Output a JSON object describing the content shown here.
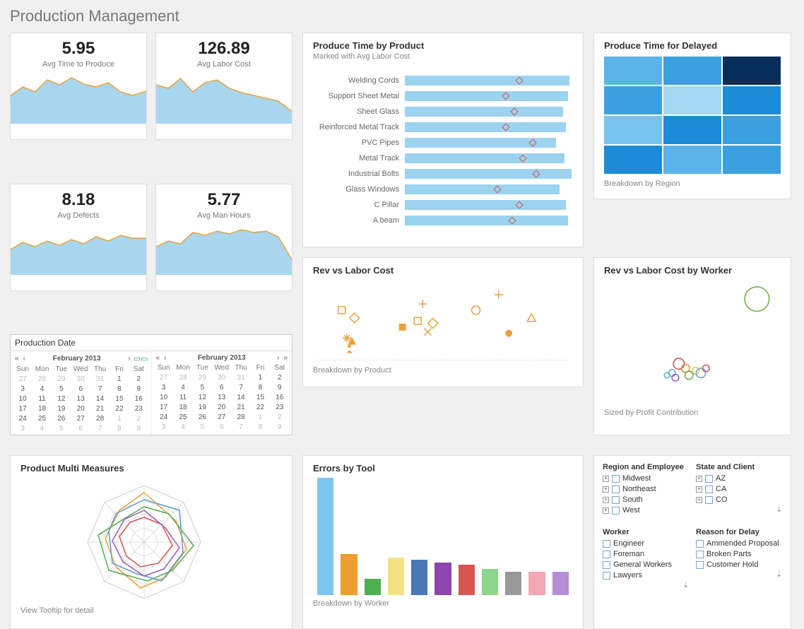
{
  "page_title": "Production Management",
  "kpis": [
    {
      "value": "5.95",
      "label": "Avg Time to Produce",
      "spark": [
        40,
        55,
        48,
        70,
        60,
        75,
        62,
        58,
        66,
        50,
        45,
        52
      ]
    },
    {
      "value": "126.89",
      "label": "Avg Labor Cost",
      "spark": [
        60,
        55,
        72,
        50,
        65,
        70,
        58,
        52,
        48,
        45,
        40,
        28
      ]
    },
    {
      "value": "8.18",
      "label": "Avg Defects",
      "spark": [
        40,
        52,
        44,
        55,
        48,
        58,
        50,
        62,
        55,
        65,
        60,
        60
      ]
    },
    {
      "value": "5.77",
      "label": "Avg Man Hours",
      "spark": [
        45,
        55,
        50,
        68,
        62,
        70,
        65,
        72,
        68,
        70,
        60,
        30
      ]
    }
  ],
  "calendar": {
    "title": "Production Date",
    "month_left": "February 2013",
    "month_right": "February 2013",
    "days": [
      "Sun",
      "Mon",
      "Tue",
      "Wed",
      "Thu",
      "Fri",
      "Sat"
    ],
    "rows": [
      [
        27,
        28,
        29,
        30,
        31,
        1,
        2
      ],
      [
        3,
        4,
        5,
        6,
        7,
        8,
        9
      ],
      [
        10,
        11,
        12,
        13,
        14,
        15,
        16
      ],
      [
        17,
        18,
        19,
        20,
        21,
        22,
        23
      ],
      [
        24,
        25,
        26,
        27,
        28,
        1,
        2
      ],
      [
        3,
        4,
        5,
        6,
        7,
        8,
        9
      ]
    ]
  },
  "produce_time": {
    "title": "Produce Time by Product",
    "subtitle": "Marked with Avg Labor Cost",
    "items": [
      {
        "label": "Welding Cords",
        "bar": 98,
        "marker": 68
      },
      {
        "label": "Support Sheet Metal",
        "bar": 97,
        "marker": 60
      },
      {
        "label": "Sheet Glass",
        "bar": 94,
        "marker": 65
      },
      {
        "label": "Reinforced Metal Track",
        "bar": 96,
        "marker": 60
      },
      {
        "label": "PVC Pipes",
        "bar": 90,
        "marker": 76
      },
      {
        "label": "Metal Track",
        "bar": 95,
        "marker": 70
      },
      {
        "label": "Industrial Bolts",
        "bar": 99,
        "marker": 78
      },
      {
        "label": "Glass Windows",
        "bar": 92,
        "marker": 55
      },
      {
        "label": "C Pillar",
        "bar": 96,
        "marker": 68
      },
      {
        "label": "A beam",
        "bar": 97,
        "marker": 64
      }
    ]
  },
  "rev_labor": {
    "title": "Rev vs Labor Cost",
    "footnote": "Breakdown by Product",
    "points": [
      {
        "x": 10,
        "y": 38,
        "shape": "square-o"
      },
      {
        "x": 15,
        "y": 48,
        "shape": "diamond-o"
      },
      {
        "x": 12,
        "y": 74,
        "shape": "burst"
      },
      {
        "x": 14,
        "y": 78,
        "shape": "triangle"
      },
      {
        "x": 13,
        "y": 88,
        "shape": "person"
      },
      {
        "x": 34,
        "y": 60,
        "shape": "square"
      },
      {
        "x": 40,
        "y": 52,
        "shape": "square-o"
      },
      {
        "x": 44,
        "y": 66,
        "shape": "x"
      },
      {
        "x": 42,
        "y": 30,
        "shape": "plus"
      },
      {
        "x": 46,
        "y": 55,
        "shape": "diamond-o"
      },
      {
        "x": 63,
        "y": 38,
        "shape": "circle-o"
      },
      {
        "x": 72,
        "y": 18,
        "shape": "plus"
      },
      {
        "x": 76,
        "y": 68,
        "shape": "circle"
      },
      {
        "x": 85,
        "y": 48,
        "shape": "triangle-o"
      }
    ]
  },
  "produce_delayed": {
    "title": "Produce Time for Delayed",
    "footnote": "Breakdown by Region",
    "cells": [
      "#5ab4ea",
      "#3aa0e0",
      "#0a2e5c",
      "#3aa0e0",
      "#a6d8f5",
      "#1d8bd8",
      "#7ac3ee",
      "#1d8bd8",
      "#3aa0e0",
      "#1d8bd8",
      "#5ab4ea",
      "#3aa0e0"
    ]
  },
  "rev_worker": {
    "title": "Rev vs Labor Cost by Worker",
    "footnote": "Sized by Profit Contribution",
    "bubbles": [
      {
        "x": 88,
        "y": 14,
        "r": 18,
        "c": "#6aaa3a"
      },
      {
        "x": 42,
        "y": 70,
        "r": 8,
        "c": "#c94a4a"
      },
      {
        "x": 46,
        "y": 74,
        "r": 6,
        "c": "#e0892c"
      },
      {
        "x": 38,
        "y": 78,
        "r": 5,
        "c": "#5a9bd5"
      },
      {
        "x": 48,
        "y": 80,
        "r": 6,
        "c": "#6aaa3a"
      },
      {
        "x": 40,
        "y": 82,
        "r": 5,
        "c": "#9b59b6"
      },
      {
        "x": 35,
        "y": 80,
        "r": 4,
        "c": "#4bbaba"
      },
      {
        "x": 52,
        "y": 76,
        "r": 5,
        "c": "#d8c24a"
      },
      {
        "x": 55,
        "y": 78,
        "r": 7,
        "c": "#5a9bd5"
      },
      {
        "x": 58,
        "y": 74,
        "r": 5,
        "c": "#c94a4a"
      }
    ]
  },
  "multi_measures": {
    "title": "Product Multi Measures",
    "footnote": "View Tooltip for detail"
  },
  "errors_tool": {
    "title": "Errors by Tool",
    "footnote": "Breakdown by Worker",
    "bars": [
      {
        "v": 100,
        "c": "#7dc7ee"
      },
      {
        "v": 35,
        "c": "#f19c2e"
      },
      {
        "v": 14,
        "c": "#4caf50"
      },
      {
        "v": 32,
        "c": "#f4e183"
      },
      {
        "v": 30,
        "c": "#4a78b5"
      },
      {
        "v": 28,
        "c": "#8e44ad"
      },
      {
        "v": 26,
        "c": "#d9534f"
      },
      {
        "v": 22,
        "c": "#8bd68b"
      },
      {
        "v": 20,
        "c": "#999"
      },
      {
        "v": 20,
        "c": "#f2a7b3"
      },
      {
        "v": 20,
        "c": "#b48ed6"
      }
    ]
  },
  "filters": {
    "region_title": "Region and Employee",
    "region_items": [
      "Midwest",
      "Northeast",
      "South",
      "West"
    ],
    "state_title": "State and Client",
    "state_items": [
      "AZ",
      "CA",
      "CO"
    ],
    "worker_title": "Worker",
    "worker_items": [
      "Engineer",
      "Foreman",
      "General Workers",
      "Lawyers"
    ],
    "reason_title": "Reason for Delay",
    "reason_items": [
      "Ammended Proposal",
      "Broken Parts",
      "Customer Hold"
    ]
  },
  "chart_data": [
    {
      "type": "bar",
      "title": "Produce Time by Product",
      "subtitle": "Marked with Avg Labor Cost",
      "categories": [
        "Welding Cords",
        "Support Sheet Metal",
        "Sheet Glass",
        "Reinforced Metal Track",
        "PVC Pipes",
        "Metal Track",
        "Industrial Bolts",
        "Glass Windows",
        "C Pillar",
        "A beam"
      ],
      "series": [
        {
          "name": "Produce Time",
          "values": [
            98,
            97,
            94,
            96,
            90,
            95,
            99,
            92,
            96,
            97
          ]
        },
        {
          "name": "Avg Labor Cost (marker)",
          "values": [
            68,
            60,
            65,
            60,
            76,
            70,
            78,
            55,
            68,
            64
          ]
        }
      ],
      "orientation": "horizontal"
    },
    {
      "type": "heatmap",
      "title": "Produce Time for Delayed",
      "rows": 4,
      "cols": 3,
      "values": [
        [
          55,
          65,
          95
        ],
        [
          65,
          30,
          80
        ],
        [
          45,
          80,
          65
        ],
        [
          80,
          55,
          65
        ]
      ],
      "note": "Breakdown by Region"
    },
    {
      "type": "scatter",
      "title": "Rev vs Labor Cost",
      "note": "Breakdown by Product",
      "points": [
        [
          10,
          62
        ],
        [
          15,
          52
        ],
        [
          12,
          26
        ],
        [
          14,
          22
        ],
        [
          13,
          12
        ],
        [
          34,
          40
        ],
        [
          40,
          48
        ],
        [
          44,
          34
        ],
        [
          42,
          70
        ],
        [
          46,
          45
        ],
        [
          63,
          62
        ],
        [
          72,
          82
        ],
        [
          76,
          32
        ],
        [
          85,
          52
        ]
      ]
    },
    {
      "type": "scatter",
      "title": "Rev vs Labor Cost by Worker",
      "note": "Sized by Profit Contribution",
      "points": [
        [
          88,
          86,
          18
        ],
        [
          42,
          30,
          8
        ],
        [
          46,
          26,
          6
        ],
        [
          38,
          22,
          5
        ],
        [
          48,
          20,
          6
        ],
        [
          40,
          18,
          5
        ],
        [
          35,
          20,
          4
        ],
        [
          52,
          24,
          5
        ],
        [
          55,
          22,
          7
        ],
        [
          58,
          26,
          5
        ]
      ]
    },
    {
      "type": "bar",
      "title": "Errors by Tool",
      "note": "Breakdown by Worker",
      "values": [
        100,
        35,
        14,
        32,
        30,
        28,
        26,
        22,
        20,
        20,
        20
      ]
    }
  ]
}
